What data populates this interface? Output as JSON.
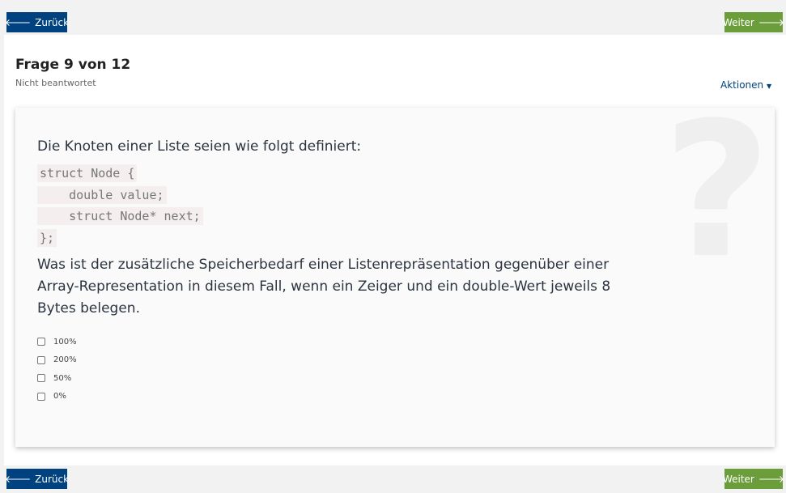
{
  "nav": {
    "back_label": "Zurück",
    "next_label": "Weiter",
    "back_icon": "arrow-left-icon",
    "next_icon": "arrow-right-icon"
  },
  "header": {
    "title": "Frage 9 von 12",
    "status": "Nicht beantwortet",
    "actions_label": "Aktionen"
  },
  "question": {
    "intro": "Die Knoten einer Liste seien wie folgt definiert:",
    "code": [
      "struct Node {",
      "    double value;",
      "    struct Node* next;",
      "};"
    ],
    "text": "Was ist der zusätzliche Speicherbedarf einer Listenrepräsentation gegenüber einer Array-Representation in diesem Fall, wenn ein Zeiger und ein double-Wert jeweils 8 Bytes belegen.",
    "options": [
      "100%",
      "200%",
      "50%",
      "0%"
    ]
  },
  "colors": {
    "back": "#00427f",
    "next": "#6b9e3a"
  }
}
